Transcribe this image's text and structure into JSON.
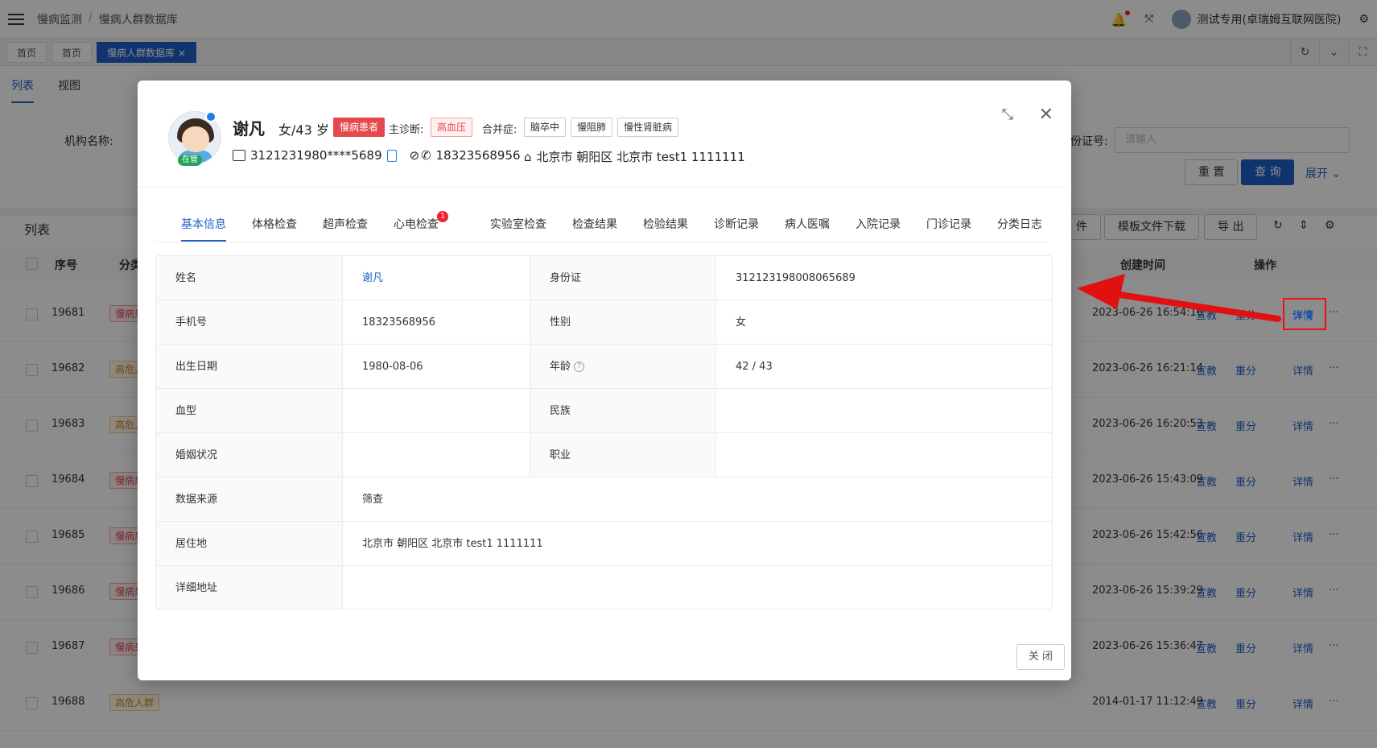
{
  "topbar": {
    "breadcrumb": [
      "慢病监测",
      "慢病人群数据库"
    ],
    "user": "测试专用(卓瑞姆互联网医院)"
  },
  "tabs": [
    {
      "label": "首页"
    },
    {
      "label": "首页"
    },
    {
      "label": "慢病人群数据库",
      "close": "×"
    }
  ],
  "page": {
    "view_tabs": [
      "列表",
      "视图"
    ],
    "filter_org_label": "机构名称:",
    "filter_id_label": "份证号:",
    "filter_id_placeholder": "请输入",
    "reset_label": "重 置",
    "query_label": "查 询",
    "expand_label": "展开",
    "list_title": "列表",
    "toolbar": [
      "件",
      "模板文件下载",
      "导 出"
    ],
    "columns": {
      "seq": "序号",
      "category": "分类",
      "created": "创建时间",
      "ops": "操作"
    },
    "rows": [
      {
        "seq": "19681",
        "tag": "慢病患",
        "tag_color": "red",
        "time": "2023-06-26 16:54:16"
      },
      {
        "seq": "19682",
        "tag": "高危人",
        "tag_color": "orange",
        "time": "2023-06-26 16:21:14"
      },
      {
        "seq": "19683",
        "tag": "高危人",
        "tag_color": "orange",
        "time": "2023-06-26 16:20:53"
      },
      {
        "seq": "19684",
        "tag": "慢病患",
        "tag_color": "red",
        "time": "2023-06-26 15:43:09"
      },
      {
        "seq": "19685",
        "tag": "慢病患",
        "tag_color": "red",
        "time": "2023-06-26 15:42:56"
      },
      {
        "seq": "19686",
        "tag": "慢病患",
        "tag_color": "red",
        "time": "2023-06-26 15:39:29"
      },
      {
        "seq": "19687",
        "tag": "慢病患",
        "tag_color": "red",
        "time": "2023-06-26 15:36:47"
      },
      {
        "seq": "19688",
        "tag": "高危人群",
        "tag_color": "orange",
        "time": "2014-01-17 11:12:49"
      }
    ],
    "row_actions": [
      "宣教",
      "重分",
      "详情",
      "···"
    ]
  },
  "modal": {
    "name": "谢凡",
    "sex_age": "女/43 岁",
    "patient_tag": "慢病患者",
    "status_badge": "在管",
    "main_dx_label": "主诊断:",
    "main_dx": "高血压",
    "comorbid_label": "合并症:",
    "comorbid": [
      "脑卒中",
      "慢阻肺",
      "慢性肾脏病"
    ],
    "id_masked": "3121231980****5689",
    "phone": "18323568956",
    "address": "北京市 朝阳区 北京市 test1 1111111",
    "tabs": [
      "基本信息",
      "体格检查",
      "超声检查",
      "心电检查",
      "实验室检查",
      "检查结果",
      "检验结果",
      "诊断记录",
      "病人医嘱",
      "入院记录",
      "门诊记录",
      "分类日志"
    ],
    "ecg_badge": "1",
    "fields": {
      "name_k": "姓名",
      "name_v": "谢凡",
      "id_k": "身份证",
      "id_v": "312123198008065689",
      "phone_k": "手机号",
      "phone_v": "18323568956",
      "sex_k": "性别",
      "sex_v": "女",
      "birth_k": "出生日期",
      "birth_v": "1980-08-06",
      "age_k": "年龄",
      "age_v": "42 / 43",
      "blood_k": "血型",
      "blood_v": "",
      "ethnic_k": "民族",
      "ethnic_v": "",
      "marital_k": "婚姻状况",
      "marital_v": "",
      "job_k": "职业",
      "job_v": "",
      "source_k": "数据来源",
      "source_v": "筛查",
      "residence_k": "居住地",
      "residence_v": "北京市 朝阳区 北京市 test1 1111111",
      "address_k": "详细地址",
      "address_v": ""
    },
    "close_label": "关 闭"
  },
  "annotation": {
    "highlight_label": "详情",
    "color": "#e11111"
  }
}
